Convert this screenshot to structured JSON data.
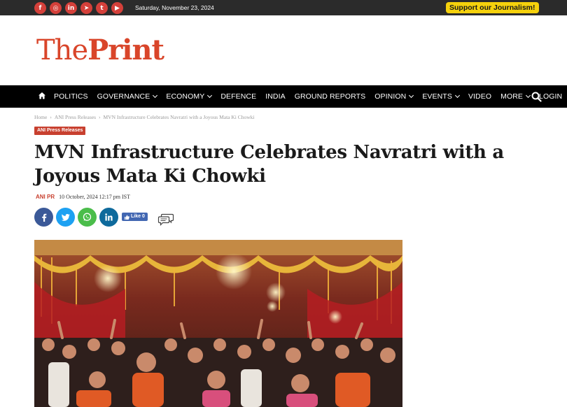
{
  "topbar": {
    "social": [
      "f",
      "◎",
      "in",
      "➤",
      "t",
      "▶"
    ],
    "date": "Saturday, November 23, 2024",
    "support_label": "Support our Journalism!"
  },
  "logo": {
    "the": "The",
    "print": "Print"
  },
  "nav": {
    "items": [
      {
        "label": "POLITICS",
        "dropdown": false
      },
      {
        "label": "GOVERNANCE",
        "dropdown": true
      },
      {
        "label": "ECONOMY",
        "dropdown": true
      },
      {
        "label": "DEFENCE",
        "dropdown": false
      },
      {
        "label": "INDIA",
        "dropdown": false
      },
      {
        "label": "GROUND REPORTS",
        "dropdown": false
      },
      {
        "label": "OPINION",
        "dropdown": true
      },
      {
        "label": "EVENTS",
        "dropdown": true
      },
      {
        "label": "VIDEO",
        "dropdown": false
      },
      {
        "label": "MORE",
        "dropdown": true
      },
      {
        "label": "LOGIN",
        "dropdown": false
      }
    ]
  },
  "breadcrumb": {
    "home": "Home",
    "section": "ANI Press Releases",
    "current": "MVN Infrastructure Celebrates Navratri with a Joyous Mata Ki Chowki",
    "separator": "›"
  },
  "article": {
    "category": "ANI Press Releases",
    "title": "MVN Infrastructure Celebrates Navratri with a Joyous Mata Ki Chowki",
    "author": "ANI PR",
    "date": "10 October, 2024 12:17 pm IST",
    "fb_like": "Like 0"
  },
  "colors": {
    "accent": "#d9452a",
    "nav_bg": "#000000",
    "support_bg": "#f5d10c"
  }
}
